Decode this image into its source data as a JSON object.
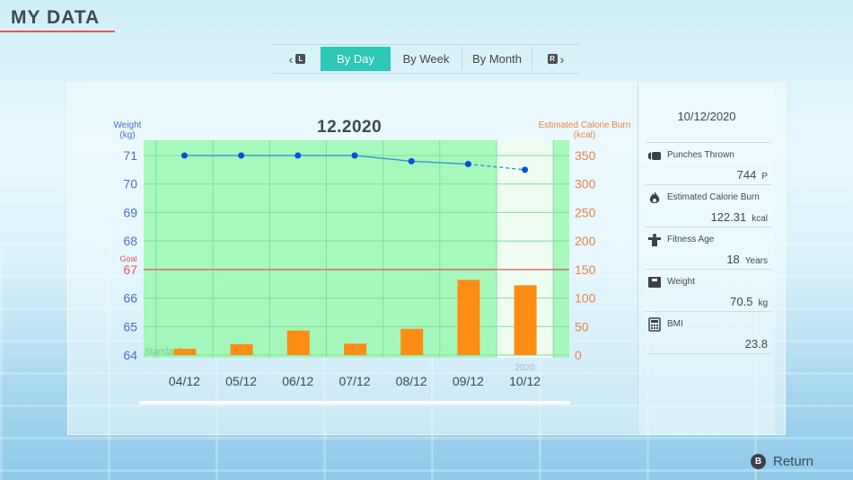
{
  "header": {
    "title": "MY DATA"
  },
  "tabs": {
    "left_button": "L",
    "right_button": "R",
    "items": [
      {
        "label": "By Day",
        "active": true
      },
      {
        "label": "By Week",
        "active": false
      },
      {
        "label": "By Month",
        "active": false
      }
    ]
  },
  "chart_data": {
    "type": "bar+line",
    "title": "12.2020",
    "categories": [
      "04/12",
      "05/12",
      "06/12",
      "07/12",
      "08/12",
      "09/12",
      "10/12"
    ],
    "selected_category": "10/12",
    "selected_year_label": "2020",
    "left_axis": {
      "label": "Weight",
      "unit": "(kg)",
      "ticks": [
        64,
        65,
        66,
        67,
        68,
        69,
        70,
        71
      ],
      "range": [
        64,
        71
      ]
    },
    "right_axis": {
      "label": "Estimated Calorie Burn",
      "unit": "(kcal)",
      "ticks": [
        0,
        50,
        100,
        150,
        200,
        250,
        300,
        350
      ],
      "range": [
        0,
        350
      ]
    },
    "goal": {
      "label": "Goal",
      "value": 67
    },
    "standard_label": "Standard",
    "series": [
      {
        "name": "Weight",
        "type": "line",
        "axis": "left",
        "values": [
          71.0,
          71.0,
          71.0,
          71.0,
          70.8,
          70.7,
          70.5
        ]
      },
      {
        "name": "Estimated Calorie Burn",
        "type": "bar",
        "axis": "right",
        "values": [
          11,
          19,
          43,
          20,
          46,
          132,
          122.31
        ]
      }
    ],
    "colors": {
      "plot_bg": "#9ef7b4",
      "bar": "#ff8c14",
      "line": "#2a8fd8",
      "point": "#0a4de0",
      "goal": "#e0585a",
      "left_axis": "#4a70c8",
      "right_axis": "#e8824a"
    }
  },
  "sidebar": {
    "date": "10/12/2020",
    "stats": [
      {
        "icon": "punch-icon",
        "label": "Punches Thrown",
        "value": "744",
        "unit": "P"
      },
      {
        "icon": "flame-icon",
        "label": "Estimated Calorie Burn",
        "value": "122.31",
        "unit": "kcal"
      },
      {
        "icon": "fitness-icon",
        "label": "Fitness Age",
        "value": "18",
        "unit": "Years"
      },
      {
        "icon": "scale-icon",
        "label": "Weight",
        "value": "70.5",
        "unit": "kg"
      },
      {
        "icon": "calculator-icon",
        "label": "BMI",
        "value": "23.8",
        "unit": ""
      }
    ]
  },
  "footer": {
    "return_button": "B",
    "return_label": "Return"
  }
}
